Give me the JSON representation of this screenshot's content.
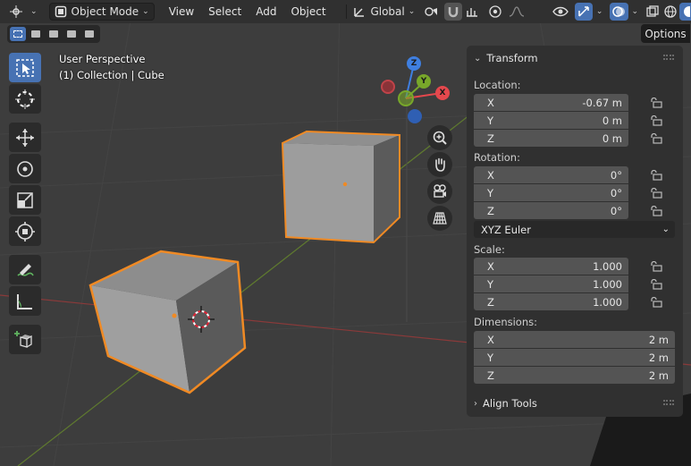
{
  "header": {
    "editor_icon": "editor-type-icon",
    "mode_label": "Object Mode",
    "menus": [
      "View",
      "Select",
      "Add",
      "Object"
    ],
    "orientation_label": "Global"
  },
  "options_button": "Options",
  "viewport": {
    "perspective": "User Perspective",
    "collection": "(1) Collection | Cube"
  },
  "gizmo": {
    "x": "X",
    "y": "Y",
    "z": "Z"
  },
  "tools": [
    "select-box-tool",
    "cursor-tool",
    "move-tool",
    "rotate-tool",
    "scale-tool",
    "transform-tool",
    "annotate-tool",
    "measure-tool",
    "add-cube-tool"
  ],
  "npanel": {
    "transform_title": "Transform",
    "location_label": "Location:",
    "location": [
      {
        "axis": "X",
        "value": "-0.67 m"
      },
      {
        "axis": "Y",
        "value": "0 m"
      },
      {
        "axis": "Z",
        "value": "0 m"
      }
    ],
    "rotation_label": "Rotation:",
    "rotation": [
      {
        "axis": "X",
        "value": "0°"
      },
      {
        "axis": "Y",
        "value": "0°"
      },
      {
        "axis": "Z",
        "value": "0°"
      }
    ],
    "rotation_mode": "XYZ Euler",
    "scale_label": "Scale:",
    "scale": [
      {
        "axis": "X",
        "value": "1.000"
      },
      {
        "axis": "Y",
        "value": "1.000"
      },
      {
        "axis": "Z",
        "value": "1.000"
      }
    ],
    "dimensions_label": "Dimensions:",
    "dimensions": [
      {
        "axis": "X",
        "value": "2 m"
      },
      {
        "axis": "Y",
        "value": "2 m"
      },
      {
        "axis": "Z",
        "value": "2 m"
      }
    ],
    "align_title": "Align Tools"
  },
  "colors": {
    "accent": "#4772b3",
    "selection": "#f08a24",
    "x_axis": "#e5484d",
    "y_axis": "#78a72a",
    "z_axis": "#3f7fe0"
  }
}
